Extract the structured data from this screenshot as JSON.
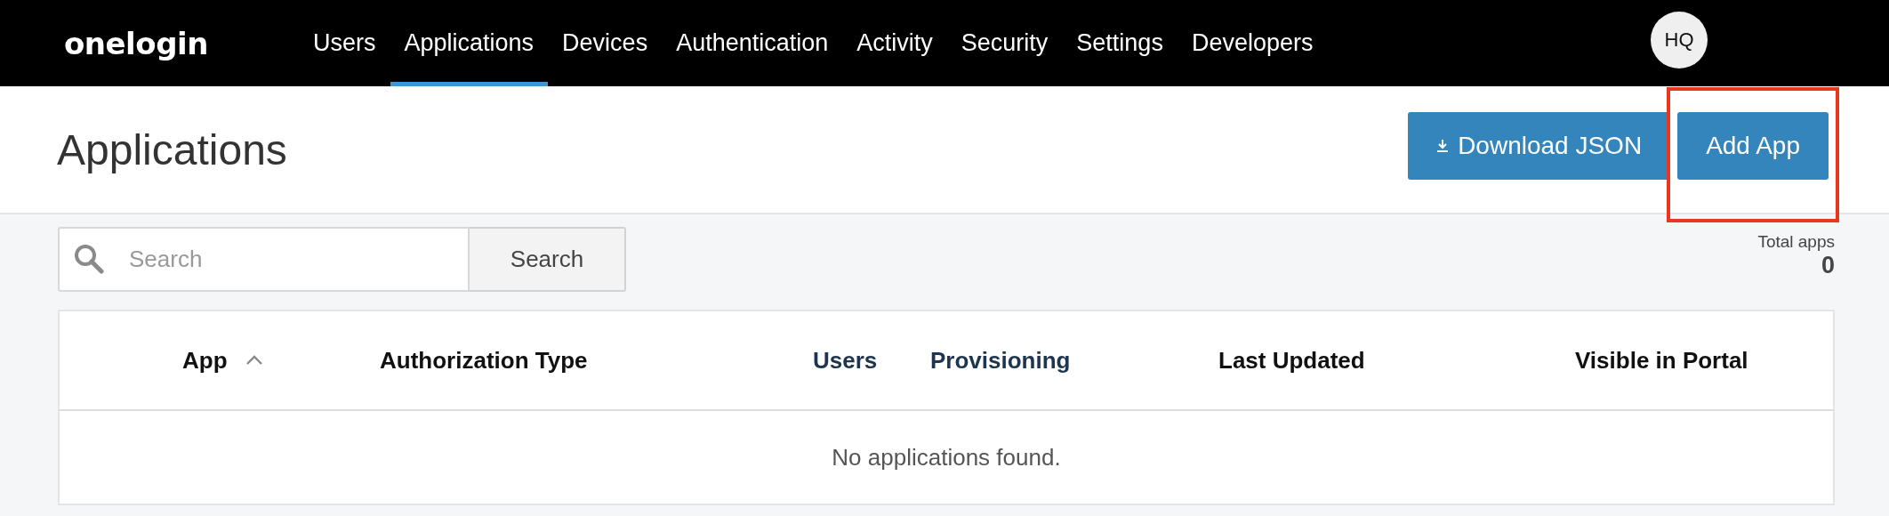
{
  "nav": {
    "logo": "onelogin",
    "items": [
      {
        "label": "Users",
        "selected": false
      },
      {
        "label": "Applications",
        "selected": true
      },
      {
        "label": "Devices",
        "selected": false
      },
      {
        "label": "Authentication",
        "selected": false
      },
      {
        "label": "Activity",
        "selected": false
      },
      {
        "label": "Security",
        "selected": false
      },
      {
        "label": "Settings",
        "selected": false
      },
      {
        "label": "Developers",
        "selected": false
      }
    ],
    "avatar": "HQ"
  },
  "header": {
    "title": "Applications",
    "buttons": [
      {
        "label": "Download JSON",
        "kind": "download",
        "highlighted": false
      },
      {
        "label": "Add App",
        "kind": "plain",
        "highlighted": true
      }
    ]
  },
  "search": {
    "placeholder": "Search",
    "button": "Search"
  },
  "total": {
    "label": "Total apps",
    "value": "0"
  },
  "table": {
    "columns": [
      {
        "label": "App",
        "link": false,
        "sorted": true
      },
      {
        "label": "Authorization Type",
        "link": false,
        "sorted": false
      },
      {
        "label": "Users",
        "link": true,
        "sorted": false
      },
      {
        "label": "Provisioning",
        "link": true,
        "sorted": false
      },
      {
        "label": "Last Updated",
        "link": false,
        "sorted": false
      },
      {
        "label": "Visible in Portal",
        "link": false,
        "sorted": false
      }
    ],
    "empty": "No applications found."
  }
}
